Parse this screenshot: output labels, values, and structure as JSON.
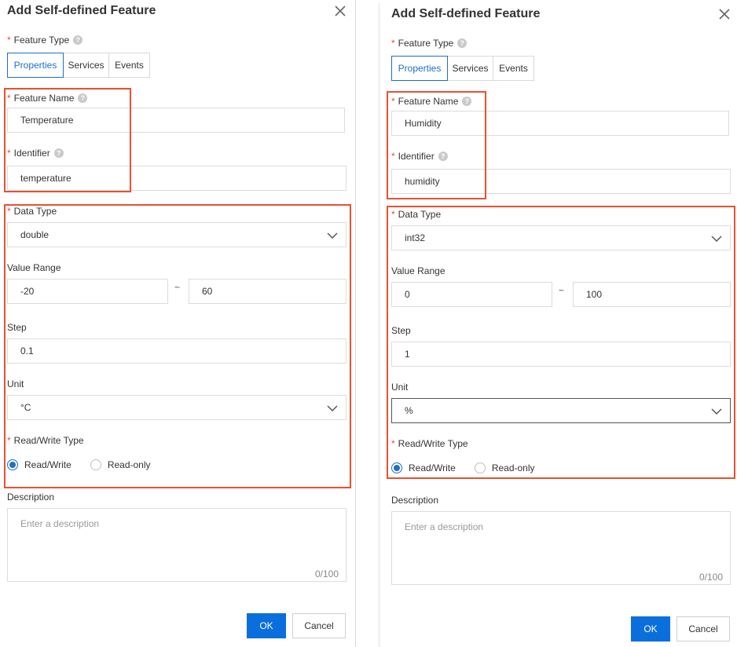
{
  "panels": [
    {
      "title": "Add Self-defined Feature",
      "feature_type_label": "Feature Type",
      "tabs": [
        {
          "label": "Properties",
          "active": true
        },
        {
          "label": "Services",
          "active": false
        },
        {
          "label": "Events",
          "active": false
        }
      ],
      "feature_name_label": "Feature Name",
      "feature_name_value": "Temperature",
      "identifier_label": "Identifier",
      "identifier_value": "temperature",
      "data_type_label": "Data Type",
      "data_type_value": "double",
      "value_range_label": "Value Range",
      "range_min": "-20",
      "range_separator": "~",
      "range_max": "60",
      "step_label": "Step",
      "step_value": "0.1",
      "unit_label": "Unit",
      "unit_value": "°C",
      "rw_label": "Read/Write Type",
      "rw_options": [
        "Read/Write",
        "Read-only"
      ],
      "rw_selected": "Read/Write",
      "description_label": "Description",
      "description_placeholder": "Enter a description",
      "description_counter": "0/100",
      "ok_label": "OK",
      "cancel_label": "Cancel"
    },
    {
      "title": "Add Self-defined Feature",
      "feature_type_label": "Feature Type",
      "tabs": [
        {
          "label": "Properties",
          "active": true
        },
        {
          "label": "Services",
          "active": false
        },
        {
          "label": "Events",
          "active": false
        }
      ],
      "feature_name_label": "Feature Name",
      "feature_name_value": "Humidity",
      "identifier_label": "Identifier",
      "identifier_value": "humidity",
      "data_type_label": "Data Type",
      "data_type_value": "int32",
      "value_range_label": "Value Range",
      "range_min": "0",
      "range_separator": "~",
      "range_max": "100",
      "step_label": "Step",
      "step_value": "1",
      "unit_label": "Unit",
      "unit_value": "%",
      "rw_label": "Read/Write Type",
      "rw_options": [
        "Read/Write",
        "Read-only"
      ],
      "rw_selected": "Read/Write",
      "description_label": "Description",
      "description_placeholder": "Enter a description",
      "description_counter": "0/100",
      "ok_label": "OK",
      "cancel_label": "Cancel"
    }
  ],
  "icons": {
    "close": "close-icon",
    "help": "help-icon",
    "chevron": "chevron-down-icon"
  },
  "help_glyph": "?",
  "colors": {
    "accent": "#1e6fc8",
    "ok_button": "#0a6fdc",
    "required_star": "#e84b3c",
    "highlight_box": "#e8512f"
  }
}
